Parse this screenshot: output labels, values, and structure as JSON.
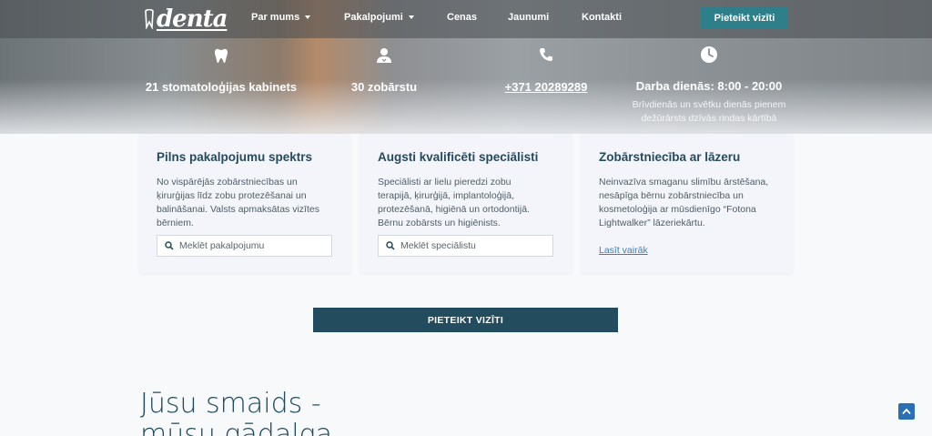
{
  "nav": {
    "logo_text": "denta",
    "items": [
      {
        "label": "Par mums",
        "has_dropdown": true
      },
      {
        "label": "Pakalpojumi",
        "has_dropdown": true
      },
      {
        "label": "Cenas",
        "has_dropdown": false
      },
      {
        "label": "Jaunumi",
        "has_dropdown": false
      },
      {
        "label": "Kontakti",
        "has_dropdown": false
      }
    ],
    "cta_label": "Pieteikt vizīti"
  },
  "stats": [
    {
      "icon": "tooth-icon",
      "label": "21 stomatoloģijas kabinets"
    },
    {
      "icon": "doctor-icon",
      "label": "30 zobārstu"
    },
    {
      "icon": "phone-icon",
      "label": "+371 20289289"
    },
    {
      "icon": "clock-icon",
      "label": "Darba dienās: 8:00 - 20:00",
      "sub1": "Brīvdienās un svētku dienās pienem",
      "sub2": "dežūrārsts dzīvās rindas kārtībā"
    }
  ],
  "cards": [
    {
      "title": "Pilns pakalpojumu spektrs",
      "lines": [
        "No vispārējās zobārstniecības un",
        "ķirurģijas līdz zobu protezēšanai un",
        "balināšanai. Valsts apmaksātas vizītes",
        "bērniem."
      ],
      "search_placeholder": "Meklēt pakalpojumu"
    },
    {
      "title": "Augsti kvalificēti speciālisti",
      "lines": [
        "Speciālisti ar lielu pieredzi zobu",
        "terapijā, ķirurģijā, implantoloģijā,",
        "protezēšanā, higiēnā un ortodontijā.",
        "Bērnu zobārsts un higiēnists."
      ],
      "search_placeholder": "Meklēt speciālistu"
    },
    {
      "title": "Zobārstniecība ar lāzeru",
      "lines": [
        "Neinvazīva smaganu slimību ārstēšana,",
        "nesāpīga bērnu zobārstniecība un",
        "kosmetoloģija ar mūsdienīgo “Fotona",
        "Lightwalker” lāzeriekārtu."
      ],
      "link_label": "Lasīt vairāk"
    }
  ],
  "main_cta_label": "PIETEIKT VIZĪTI",
  "headline": {
    "line1": "Jūsu smaids -",
    "line2": "mūsu gādalga"
  },
  "colors": {
    "accent": "#2e7f8a",
    "navy": "#234c5f",
    "title": "#274a5c",
    "link": "#3a7fb6",
    "scroll_top": "#2b6fb6"
  }
}
